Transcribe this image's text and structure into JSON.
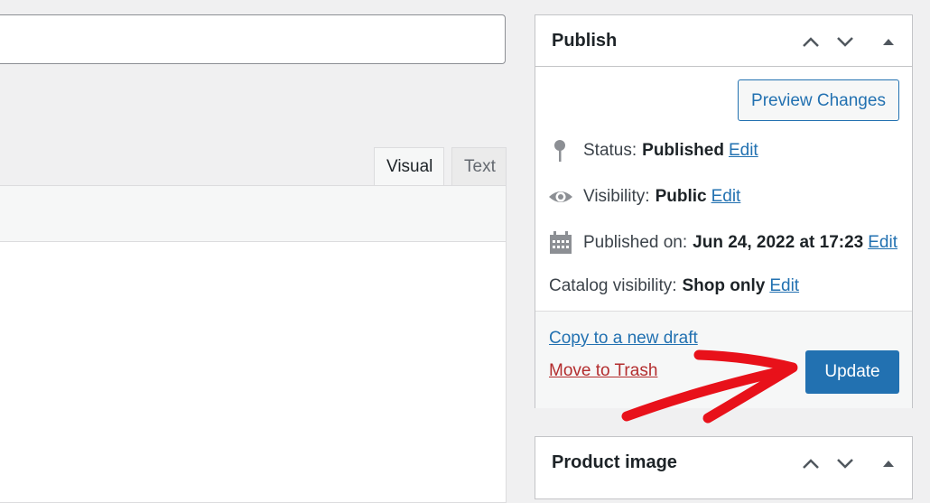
{
  "editor": {
    "tabs": [
      {
        "label": "Visual"
      },
      {
        "label": "Text"
      }
    ]
  },
  "publish": {
    "title": "Publish",
    "preview_label": "Preview Changes",
    "status": {
      "label": "Status:",
      "value": "Published",
      "edit": "Edit",
      "icon": "pin-icon"
    },
    "visibility": {
      "label": "Visibility:",
      "value": "Public",
      "edit": "Edit",
      "icon": "eye-icon"
    },
    "published_on": {
      "label": "Published on:",
      "value": "Jun 24, 2022 at 17:23",
      "edit": "Edit",
      "icon": "calendar-icon"
    },
    "catalog": {
      "label": "Catalog visibility:",
      "value": "Shop only",
      "edit": "Edit"
    },
    "copy_label": "Copy to a new draft",
    "trash_label": "Move to Trash",
    "update_label": "Update"
  },
  "product_image": {
    "title": "Product image"
  },
  "colors": {
    "primary": "#2271b1",
    "danger": "#b32d2e",
    "annotation": "#e8111a"
  }
}
